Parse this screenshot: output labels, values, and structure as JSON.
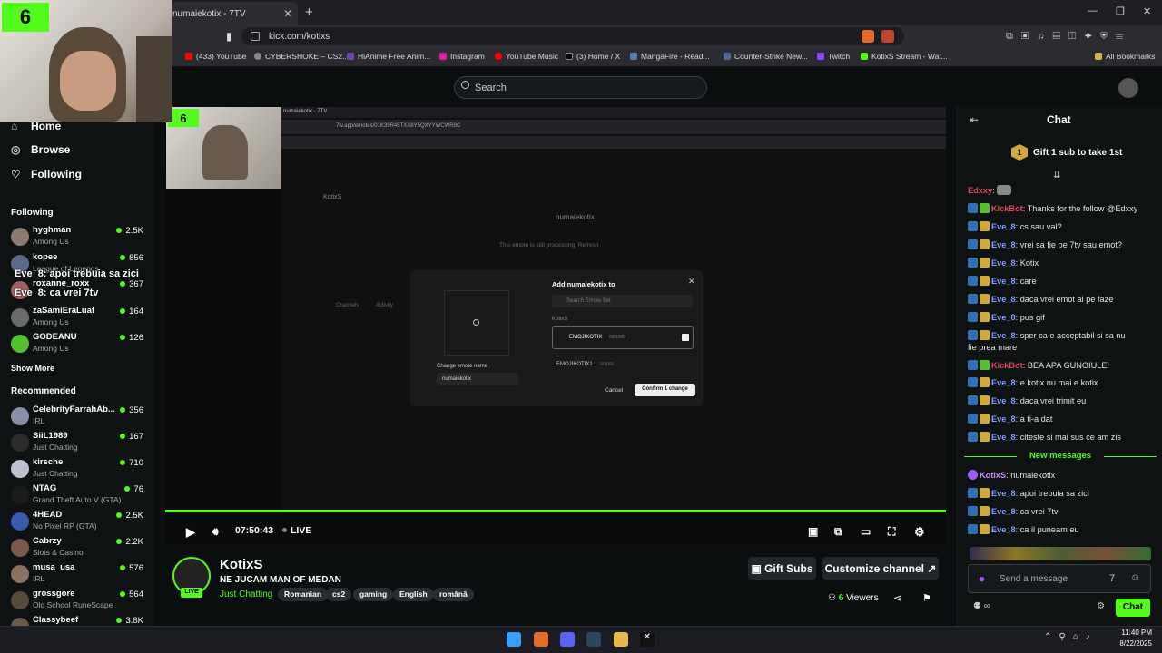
{
  "browser": {
    "tab_title": "numaiekotix - 7TV",
    "url": "kick.com/kotixs",
    "bookmarks": [
      "(433) YouTube",
      "CYBERSHOKE – CS2...",
      "HiAnime Free Anim...",
      "Instagram",
      "YouTube Music",
      "(3) Home / X",
      "MangaFire - Read...",
      "Counter-Strike New...",
      "Twitch",
      "KotixS Stream - Wat..."
    ],
    "all_bookmarks": "All Bookmarks"
  },
  "header": {
    "search_placeholder": "Search"
  },
  "facecam": {
    "badge": "6"
  },
  "sidebar": {
    "nav": [
      "Home",
      "Browse",
      "Following"
    ],
    "following_title": "Following",
    "following": [
      {
        "name": "hyghman",
        "game": "Among Us",
        "viewers": "2.5K",
        "color": "#8a7a70"
      },
      {
        "name": "kopee",
        "game": "League of Legends",
        "viewers": "856",
        "color": "#5a6a8a"
      },
      {
        "name": "roxanne_roxx",
        "game": "",
        "viewers": "367",
        "color": "#a06060"
      },
      {
        "name": "zaSamiEraLuat",
        "game": "Among Us",
        "viewers": "164",
        "color": "#6a6a6a"
      },
      {
        "name": "GODEANU",
        "game": "Among Us",
        "viewers": "126",
        "color": "#53c12f"
      }
    ],
    "show_more": "Show More",
    "recommended_title": "Recommended",
    "recommended": [
      {
        "name": "CelebrityFarrahAb...",
        "game": "IRL",
        "viewers": "356",
        "color": "#8a8fa8"
      },
      {
        "name": "SiiL1989",
        "game": "Just Chatting",
        "viewers": "167",
        "color": "#2a2a2a"
      },
      {
        "name": "kirsche",
        "game": "Just Chatting",
        "viewers": "710",
        "color": "#c0c0d0"
      },
      {
        "name": "NTAG",
        "game": "Grand Theft Auto V (GTA)",
        "viewers": "76",
        "color": "#1a1a1a"
      },
      {
        "name": "4HEAD",
        "game": "No Pixel RP (GTA)",
        "viewers": "2.5K",
        "color": "#3a5ab0"
      },
      {
        "name": "Cabrzy",
        "game": "Slots & Casino",
        "viewers": "2.2K",
        "color": "#7a5a4a"
      },
      {
        "name": "musa_usa",
        "game": "IRL",
        "viewers": "576",
        "color": "#8a7060"
      },
      {
        "name": "grossgore",
        "game": "Old School RuneScape",
        "viewers": "564",
        "color": "#5a4a3a"
      },
      {
        "name": "Classybeef",
        "game": "",
        "viewers": "3.8K",
        "color": "#6a5a4a"
      }
    ]
  },
  "overlay_chat": [
    "Eve_8: apoi trebuia sa zici",
    "Eve_8: ca vrei 7tv"
  ],
  "inner_screen": {
    "tab": "numaiekotix - 7TV",
    "url": "7tv.app/emotes/01K39R45TXX8Y5QXYYWCWR8C",
    "channel": "KotixS",
    "title": "numaiekotix",
    "processing": "This emote is still processing. Refresh",
    "modal_title": "Add numaiekotix to",
    "modal_search": "Search Emote Set",
    "set_owner": "KotixS",
    "set1": "EMOJIKOTIX",
    "set1_count": "89/1000",
    "set2": "EMOJIKOTIX1",
    "set2_count": "0/1000",
    "change_name": "Change emote name",
    "name_value": "numaiekotix",
    "cancel": "Cancel",
    "confirm": "Confirm 1 change",
    "channels": "Channels",
    "activity": "Activity"
  },
  "player": {
    "time": "07:50:43",
    "live": "LIVE"
  },
  "stream": {
    "channel": "KotixS",
    "live_badge": "LIVE",
    "title": "NE JUCAM MAN OF MEDAN",
    "category": "Just Chatting",
    "tags": [
      "Romanian",
      "cs2",
      "gaming",
      "English",
      "română"
    ],
    "gift_subs": "Gift Subs",
    "customize": "Customize channel",
    "viewers": "6",
    "viewers_label": "Viewers"
  },
  "chat": {
    "title": "Chat",
    "gift_banner": "Gift 1 sub to take 1st",
    "gift_num": "1",
    "messages": [
      {
        "user": "Edxxy",
        "text": "",
        "color": "#e0455a",
        "badges": []
      },
      {
        "user": "KickBot",
        "text": "Thanks for the follow @Edxxy",
        "color": "#e0455a",
        "badges": [
          "b1",
          "b3"
        ]
      },
      {
        "user": "Eve_8",
        "text": "cs sau val?",
        "color": "#7f9cff",
        "badges": [
          "b1",
          "b2"
        ]
      },
      {
        "user": "Eve_8",
        "text": "vrei sa fie pe 7tv sau emot?",
        "color": "#7f9cff",
        "badges": [
          "b1",
          "b2"
        ]
      },
      {
        "user": "Eve_8",
        "text": "Kotix",
        "color": "#7f9cff",
        "badges": [
          "b1",
          "b2"
        ]
      },
      {
        "user": "Eve_8",
        "text": "care",
        "color": "#7f9cff",
        "badges": [
          "b1",
          "b2"
        ]
      },
      {
        "user": "Eve_8",
        "text": "daca vrei emot ai pe faze",
        "color": "#7f9cff",
        "badges": [
          "b1",
          "b2"
        ]
      },
      {
        "user": "Eve_8",
        "text": "pus gif",
        "color": "#7f9cff",
        "badges": [
          "b1",
          "b2"
        ]
      },
      {
        "user": "Eve_8",
        "text": "sper ca e acceptabil si sa nu",
        "color": "#7f9cff",
        "badges": [
          "b1",
          "b2"
        ]
      },
      {
        "user": "",
        "text": "fie prea mare",
        "color": "#7f9cff",
        "badges": []
      },
      {
        "user": "KickBot",
        "text": "BEA APA GUNOIULE!",
        "color": "#e0455a",
        "badges": [
          "b1",
          "b3"
        ]
      },
      {
        "user": "Eve_8",
        "text": "e kotix nu mai e kotix",
        "color": "#7f9cff",
        "badges": [
          "b1",
          "b2"
        ]
      },
      {
        "user": "Eve_8",
        "text": "daca vrei trimit eu",
        "color": "#7f9cff",
        "badges": [
          "b1",
          "b2"
        ]
      },
      {
        "user": "Eve_8",
        "text": "a ti-a dat",
        "color": "#7f9cff",
        "badges": [
          "b1",
          "b2"
        ]
      },
      {
        "user": "Eve_8",
        "text": "citeste si mai sus ce am zis",
        "color": "#7f9cff",
        "badges": [
          "b1",
          "b2"
        ]
      }
    ],
    "new_messages": "New messages",
    "messages_after": [
      {
        "user": "KotixS",
        "text": "numaiekotix",
        "color": "#c58cff",
        "badges": [
          "mic"
        ]
      },
      {
        "user": "Eve_8",
        "text": "apoi trebuia sa zici",
        "color": "#7f9cff",
        "badges": [
          "b1",
          "b2"
        ]
      },
      {
        "user": "Eve_8",
        "text": "ca vrei 7tv",
        "color": "#7f9cff",
        "badges": [
          "b1",
          "b2"
        ]
      },
      {
        "user": "Eve_8",
        "text": "ca il puneam eu",
        "color": "#7f9cff",
        "badges": [
          "b1",
          "b2"
        ]
      }
    ],
    "input_placeholder": "Send a message",
    "send": "Chat"
  },
  "taskbar": {
    "time": "11:40 PM",
    "date": "8/22/2025"
  },
  "colors": {
    "accent": "#53fc18",
    "bg": "#0b0e0f"
  }
}
